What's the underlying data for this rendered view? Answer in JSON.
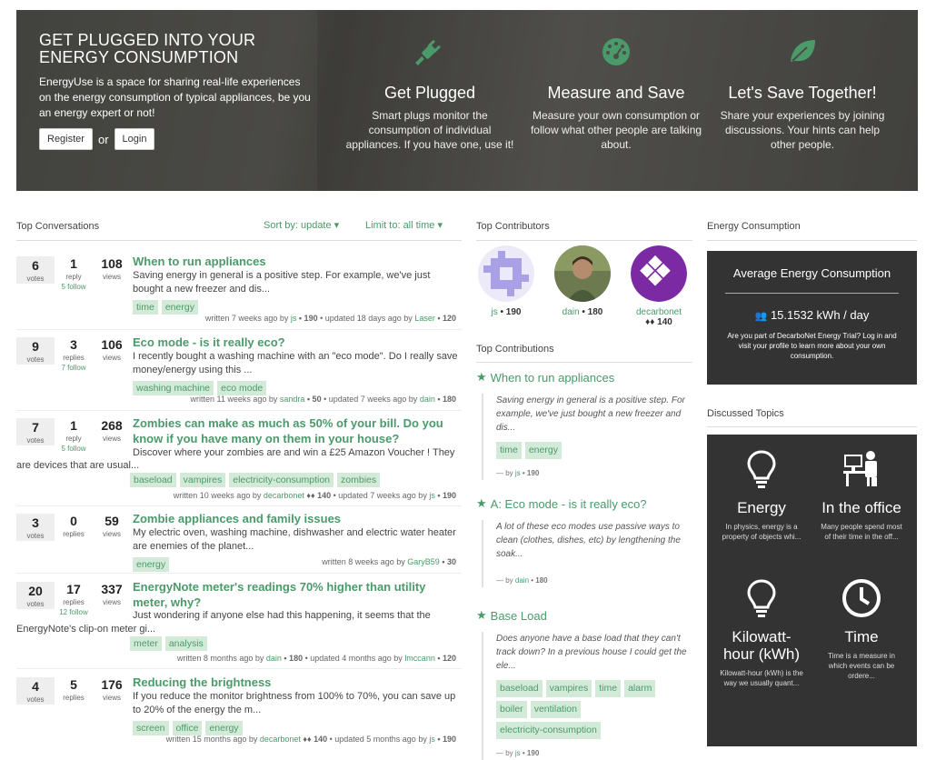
{
  "hero": {
    "title": "GET PLUGGED INTO YOUR ENERGY CONSUMPTION",
    "intro": "EnergyUse is a space for sharing real-life experiences on the energy consumption of typical appliances, be you an energy expert or not!",
    "register_label": "Register",
    "or_label": "or",
    "login_label": "Login",
    "features": [
      {
        "icon": "plug-icon",
        "title": "Get Plugged",
        "text": "Smart plugs monitor the consumption of individual appliances. If you have one, use it!"
      },
      {
        "icon": "gauge-icon",
        "title": "Measure and Save",
        "text": "Measure your own consumption or follow what other people are talking about."
      },
      {
        "icon": "leaf-icon",
        "title": "Let's Save Together!",
        "text": "Share your experiences by joining discussions. Your hints can help other people."
      }
    ]
  },
  "conversations": {
    "title": "Top Conversations",
    "sort_label": "Sort by: update",
    "limit_label": "Limit to: all time",
    "items": [
      {
        "votes": "6",
        "votes_label": "votes",
        "replies": "1",
        "replies_label": "reply",
        "follow": "5 follow",
        "views": "108",
        "views_label": "views",
        "title": "When to run appliances",
        "snippet": "Saving energy in general is a positive step. For example, we've just bought a new freezer and dis...",
        "tags": [
          "time",
          "energy"
        ],
        "meta_pre": "written 7 weeks ago by ",
        "author": "js",
        "author_rep": " • 190",
        "meta_mid": " • updated 18 days ago by ",
        "updater": "Laser",
        "updater_rep": " • 120"
      },
      {
        "votes": "9",
        "votes_label": "votes",
        "replies": "3",
        "replies_label": "replies",
        "follow": "7 follow",
        "views": "106",
        "views_label": "views",
        "title": "Eco mode - is it really eco?",
        "snippet": "I recently bought a washing machine with an \"eco mode\". Do I really save money/energy using this ...",
        "tags": [
          "washing machine",
          "eco mode"
        ],
        "meta_pre": "written 11 weeks ago by ",
        "author": "sandra",
        "author_rep": " • 50",
        "meta_mid": " • updated 7 weeks ago by ",
        "updater": "dain",
        "updater_rep": " • 180"
      },
      {
        "votes": "7",
        "votes_label": "votes",
        "replies": "1",
        "replies_label": "reply",
        "follow": "5 follow",
        "views": "268",
        "views_label": "views",
        "title": "Zombies can make as much as 50% of your bill. Do you know if you have many on them in your house?",
        "snippet": "Discover where your zombies are and win a £25 Amazon Voucher ! They",
        "snippet2": "are devices that are usual...",
        "tags": [
          "baseload",
          "vampires",
          "electricity-consumption",
          "zombies"
        ],
        "meta_pre": "written 10 weeks ago by ",
        "author": "decarbonet",
        "author_rep": " ♦♦ 140",
        "meta_mid": " • updated 7 weeks ago by ",
        "updater": "js",
        "updater_rep": " • 190"
      },
      {
        "votes": "3",
        "votes_label": "votes",
        "replies": "0",
        "replies_label": "replies",
        "follow": "",
        "views": "59",
        "views_label": "views",
        "title": "Zombie appliances and family issues",
        "snippet": "My electric oven, washing machine, dishwasher and electric water heater are enemies of the planet...",
        "tags": [
          "energy"
        ],
        "meta_pre": "written 8 weeks ago by ",
        "author": "GaryB59",
        "author_rep": " • 30",
        "meta_mid": "",
        "updater": "",
        "updater_rep": ""
      },
      {
        "votes": "20",
        "votes_label": "votes",
        "replies": "17",
        "replies_label": "replies",
        "follow": "12 follow",
        "views": "337",
        "views_label": "views",
        "title": "EnergyNote meter's readings 70% higher than utility meter, why?",
        "snippet": "Just wondering if anyone else had this happening, it seems that the",
        "snippet2": "EnergyNote's clip-on meter gi...",
        "tags": [
          "meter",
          "analysis"
        ],
        "meta_pre": "written 8 months ago by ",
        "author": "dain",
        "author_rep": " • 180",
        "meta_mid": " • updated 4 months ago by ",
        "updater": "lmccann",
        "updater_rep": " • 120"
      },
      {
        "votes": "4",
        "votes_label": "votes",
        "replies": "5",
        "replies_label": "replies",
        "follow": "",
        "views": "176",
        "views_label": "views",
        "title": "Reducing the brightness",
        "snippet": "If you reduce the monitor brightness from 100% to 70%, you can save up to 20% of the energy the m...",
        "tags": [
          "screen",
          "office",
          "energy"
        ],
        "meta_pre": "written 15 months ago by ",
        "author": "decarbonet",
        "author_rep": " ♦♦ 140",
        "meta_mid": " • updated 5 months ago by ",
        "updater": "js",
        "updater_rep": " • 190"
      }
    ]
  },
  "contributors": {
    "title": "Top Contributors",
    "items": [
      {
        "name": "js",
        "rep": " • 190"
      },
      {
        "name": "dain",
        "rep": " • 180"
      },
      {
        "name": "decarbonet",
        "rep": "♦♦ 140"
      }
    ]
  },
  "contributions": {
    "title": "Top Contributions",
    "items": [
      {
        "title": "When to run appliances",
        "snippet": "Saving energy in general is a positive step. For example, we've just bought a new freezer and dis...",
        "tags": [
          "time",
          "energy"
        ],
        "by_pre": "— by ",
        "author": "js",
        "rep": " • 190"
      },
      {
        "title": "A: Eco mode - is it really eco?",
        "snippet": "A lot of these eco modes use passive ways to clean (clothes, dishes, etc) by lengthening the soak...",
        "tags": [],
        "by_pre": "— by ",
        "author": "dain",
        "rep": " • 180"
      },
      {
        "title": "Base Load",
        "snippet": "Does anyone have a base load that they can't track down? In a previous house I could get the ele...",
        "tags": [
          "baseload",
          "vampires",
          "time",
          "alarm",
          "boiler",
          "ventilation",
          "electricity-consumption"
        ],
        "by_pre": "— by ",
        "author": "js",
        "rep": " • 190"
      }
    ]
  },
  "energy": {
    "title": "Energy Consumption",
    "box_title": "Average Energy Consumption",
    "value": "15.1532 kWh / day",
    "note": "Are you part of DecarboNet Energy Trial? Log in and visit your profile to learn more about your own consumption."
  },
  "topics": {
    "title": "Discussed Topics",
    "items": [
      {
        "icon": "lightbulb-icon",
        "title": "Energy",
        "text": "In physics, energy is a property of objects whi..."
      },
      {
        "icon": "office-icon",
        "title": "In the office",
        "text": "Many people spend most of their time in the off..."
      },
      {
        "icon": "lightbulb-icon",
        "title": "Kilowatt-hour (kWh)",
        "text": "Kilowatt-hour (kWh) is the way we usually quant..."
      },
      {
        "icon": "clock-icon",
        "title": "Time",
        "text": "Time is a measure in which events can be ordere..."
      }
    ]
  },
  "colors": {
    "accent": "#4a9a6a",
    "tag_bg": "#d4ead9",
    "dark_box": "#333333"
  }
}
